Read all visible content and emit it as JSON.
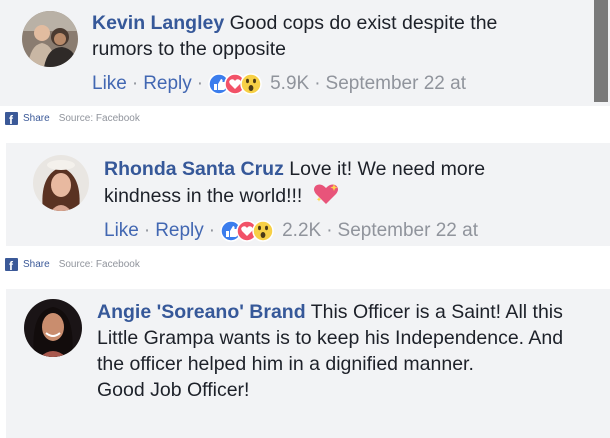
{
  "colors": {
    "card_bg": "#f2f3f5",
    "name": "#365899",
    "link": "#4267b2",
    "meta": "#90949c",
    "like_blue": "#3b7ded",
    "love_red": "#f25268",
    "wow_yellow": "#f7d046"
  },
  "comments": [
    {
      "name": "Kevin Langley",
      "body": "Good cops do exist despite the rumors to the opposite",
      "like": "Like",
      "reply": "Reply",
      "dot": "·",
      "reactions": [
        "like-icon",
        "love-icon",
        "wow-icon"
      ],
      "count": "5.9K",
      "date": "September 22 at"
    },
    {
      "name": "Rhonda Santa Cruz",
      "body": "Love it! We need more kindness in the world!!!",
      "emoji": "sparkling-heart-icon",
      "like": "Like",
      "reply": "Reply",
      "dot": "·",
      "reactions": [
        "like-icon",
        "love-icon",
        "wow-icon"
      ],
      "count": "2.2K",
      "date": "September 22 at"
    },
    {
      "name": "Angie 'Soreano' Brand",
      "body": "This Officer is a Saint! All this Little Grampa wants is to keep his Independence. And the officer helped him in a dignified manner.",
      "body2": "Good Job Officer!"
    }
  ],
  "share": {
    "icon": "facebook-icon",
    "icon_glyph": "f",
    "label": "Share",
    "source": "Source: Facebook"
  }
}
